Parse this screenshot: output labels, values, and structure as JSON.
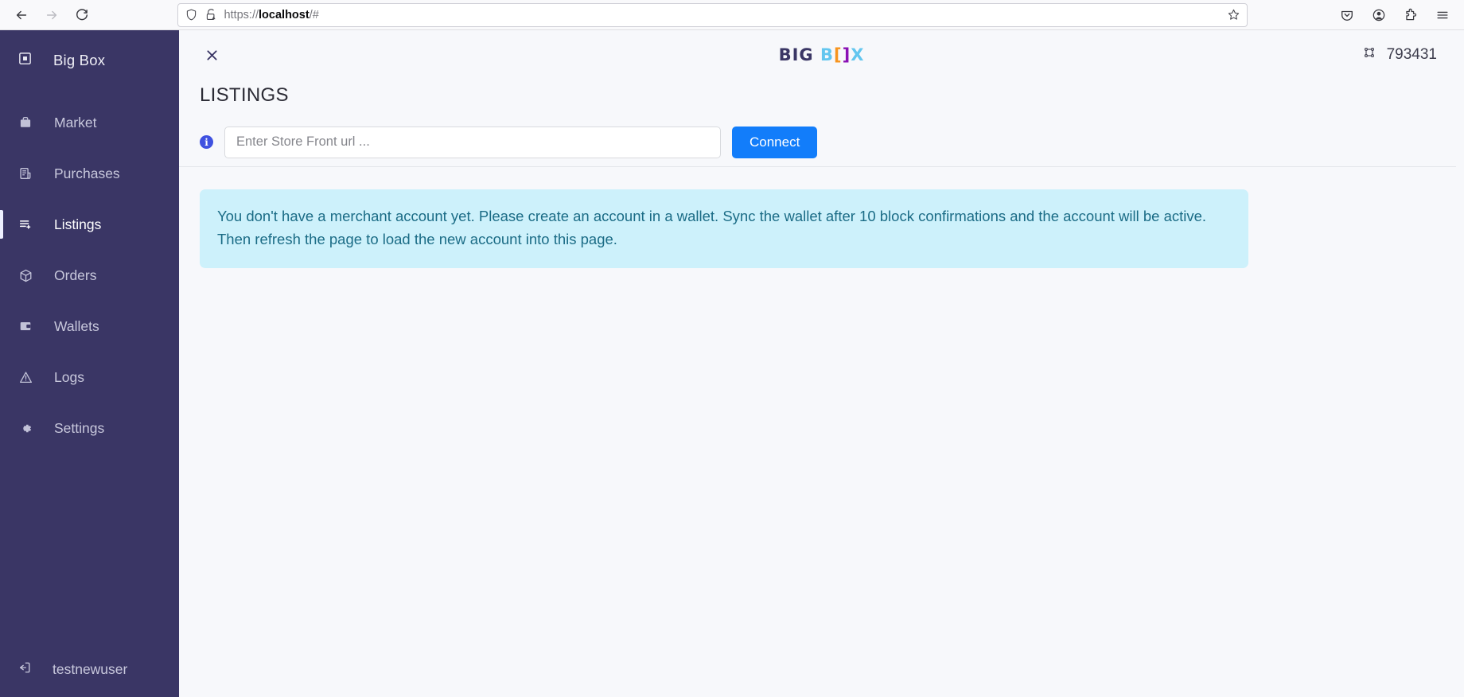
{
  "browser": {
    "back_icon": "back-arrow-icon",
    "forward_icon": "forward-arrow-icon",
    "reload_icon": "reload-icon",
    "shield_icon": "shield-icon",
    "lock_warning_icon": "lock-warning-icon",
    "url_scheme": "https://",
    "url_host": "localhost",
    "url_path": "/#",
    "bookmark_icon": "star-icon",
    "pocket_icon": "pocket-icon",
    "account_icon": "account-icon",
    "extensions_icon": "extensions-puzzle-icon",
    "menu_icon": "hamburger-menu-icon"
  },
  "sidebar": {
    "brand": "Big Box",
    "brand_icon": "app-square-icon",
    "items": [
      {
        "label": "Market",
        "icon": "briefcase-icon",
        "active": false
      },
      {
        "label": "Purchases",
        "icon": "receipt-icon",
        "active": false
      },
      {
        "label": "Listings",
        "icon": "list-add-icon",
        "active": true
      },
      {
        "label": "Orders",
        "icon": "package-icon",
        "active": false
      },
      {
        "label": "Wallets",
        "icon": "wallet-icon",
        "active": false
      },
      {
        "label": "Logs",
        "icon": "warning-triangle-icon",
        "active": false
      },
      {
        "label": "Settings",
        "icon": "gear-icon",
        "active": false
      }
    ],
    "user": "testnewuser",
    "user_icon": "logout-icon"
  },
  "header": {
    "close_icon": "close-x-icon",
    "logo": {
      "big": "BIG",
      "b": "B",
      "left_bracket": "[",
      "right_bracket": "]",
      "x": "X"
    },
    "block_icon": "block-cube-icon",
    "block_height": "793431"
  },
  "page": {
    "title": "LISTINGS",
    "info_icon": "info-icon",
    "info_glyph": "i",
    "store_url_value": "",
    "store_url_placeholder": "Enter Store Front url ...",
    "connect_label": "Connect",
    "alert_message": "You don't have a merchant account yet. Please create an account in a wallet. Sync the wallet after 10 block confirmations and the account will be active. Then refresh the page to load the new account into this page."
  },
  "colors": {
    "sidebar_bg": "#3a3665",
    "accent_blue": "#127dfa",
    "alert_bg": "#cdf1fb",
    "alert_text": "#1b6c86",
    "logo_big": "#3a3665",
    "logo_blue": "#63c6ef",
    "logo_orange": "#f7941e",
    "logo_purple": "#8a10b4"
  }
}
